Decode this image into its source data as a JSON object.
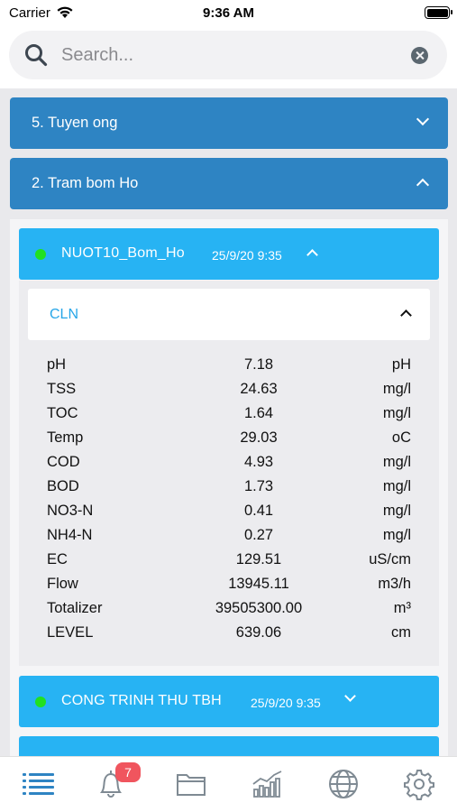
{
  "status_bar": {
    "carrier": "Carrier",
    "time": "9:36 AM"
  },
  "search": {
    "placeholder": "Search...",
    "value": ""
  },
  "groups": [
    {
      "label": "5. Tuyen ong",
      "expanded": false
    },
    {
      "label": "2. Tram bom Ho",
      "expanded": true
    }
  ],
  "stations": [
    {
      "name": "NUOT10_Bom_Ho",
      "time": "25/9/20 9:35",
      "status_color": "#21e021",
      "expanded": true
    },
    {
      "name": "CONG TRINH THU TBH",
      "time": "25/9/20 9:35",
      "status_color": "#21e021",
      "expanded": false
    }
  ],
  "category": {
    "label": "CLN",
    "expanded": true
  },
  "parameters": [
    {
      "name": "pH",
      "value": "7.18",
      "unit": "pH"
    },
    {
      "name": "TSS",
      "value": "24.63",
      "unit": "mg/l"
    },
    {
      "name": "TOC",
      "value": "1.64",
      "unit": "mg/l"
    },
    {
      "name": "Temp",
      "value": "29.03",
      "unit": "oC"
    },
    {
      "name": "COD",
      "value": "4.93",
      "unit": "mg/l"
    },
    {
      "name": "BOD",
      "value": "1.73",
      "unit": "mg/l"
    },
    {
      "name": "NO3-N",
      "value": "0.41",
      "unit": "mg/l"
    },
    {
      "name": "NH4-N",
      "value": "0.27",
      "unit": "mg/l"
    },
    {
      "name": "EC",
      "value": "129.51",
      "unit": "uS/cm"
    },
    {
      "name": "Flow",
      "value": "13945.11",
      "unit": "m3/h"
    },
    {
      "name": "Totalizer",
      "value": "39505300.00",
      "unit": "m³"
    },
    {
      "name": "LEVEL",
      "value": "639.06",
      "unit": "cm"
    }
  ],
  "tab_bar": {
    "tabs": [
      {
        "icon": "list-icon",
        "active": true
      },
      {
        "icon": "bell-icon",
        "active": false
      },
      {
        "icon": "folder-icon",
        "active": false
      },
      {
        "icon": "chart-icon",
        "active": false
      },
      {
        "icon": "globe-icon",
        "active": false
      },
      {
        "icon": "gear-icon",
        "active": false
      }
    ],
    "notification_count": "7"
  },
  "colors": {
    "group_header": "#2e84c3",
    "station_header": "#27b3f3",
    "category_label": "#27a6e8",
    "status_online": "#21e021",
    "badge": "#f0555e",
    "icon_gray": "#7f8a93",
    "active_tab": "#2e84c3"
  }
}
